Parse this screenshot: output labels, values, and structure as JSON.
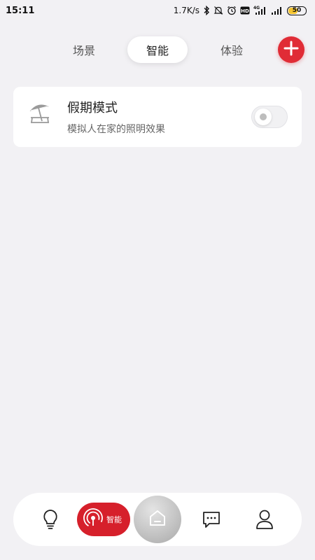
{
  "status_bar": {
    "time": "15:11",
    "speed": "1.7K/s",
    "network": "4G",
    "hd_badge": "HD",
    "battery_level": "50",
    "icons": [
      "bluetooth-icon",
      "mute-icon",
      "alarm-icon",
      "hd-icon",
      "signal-icon",
      "battery-icon"
    ]
  },
  "tabs": [
    {
      "label": "场景",
      "active": false
    },
    {
      "label": "智能",
      "active": true
    },
    {
      "label": "体验",
      "active": false
    }
  ],
  "add_button": {
    "icon": "plus-icon",
    "color": "#e02c36"
  },
  "cards": [
    {
      "icon": "beach-umbrella-icon",
      "title": "假期模式",
      "description": "模拟人在家的照明效果",
      "toggle_on": false
    }
  ],
  "bottom_nav": {
    "items": [
      {
        "icon": "lightbulb-icon"
      },
      {
        "icon": "smart-signal-icon",
        "label": "智能",
        "active": true
      },
      {
        "icon": "home-icon"
      },
      {
        "icon": "message-icon"
      },
      {
        "icon": "user-icon"
      }
    ]
  },
  "colors": {
    "accent": "#e02c36",
    "background": "#f2f1f4",
    "card": "#ffffff"
  }
}
